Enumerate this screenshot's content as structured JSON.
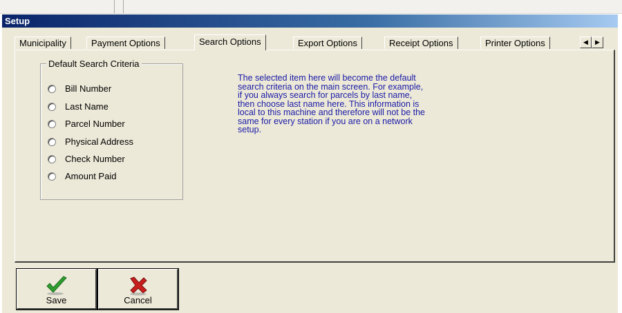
{
  "window": {
    "title": "Setup"
  },
  "tabs": [
    {
      "label": "Municipality"
    },
    {
      "label": "Payment Options"
    },
    {
      "label": "Search Options"
    },
    {
      "label": "Export Options"
    },
    {
      "label": "Receipt Options"
    },
    {
      "label": "Printer Options"
    }
  ],
  "active_tab": "Search Options",
  "group": {
    "legend": "Default Search Criteria",
    "options": [
      {
        "label": "Bill Number"
      },
      {
        "label": "Last Name"
      },
      {
        "label": "Parcel Number"
      },
      {
        "label": "Physical Address"
      },
      {
        "label": "Check Number"
      },
      {
        "label": "Amount Paid"
      }
    ]
  },
  "info": {
    "lines": [
      "The selected item here will become the default",
      "search criteria on the main screen.  For example,",
      "if you always search for parcels by last name,",
      "then choose last name here.  This information is",
      "local to this machine and therefore will not be the",
      "same for every station if you are on a network",
      "setup."
    ]
  },
  "buttons": {
    "save_label": "Save",
    "save_icon": "checkmark-icon",
    "cancel_label": "Cancel",
    "cancel_icon": "x-icon"
  },
  "colors": {
    "titlebar": "#0a246a",
    "info_text": "#1a1aa6",
    "check_green": "#2e9e2e",
    "cancel_red": "#c81e1e"
  }
}
